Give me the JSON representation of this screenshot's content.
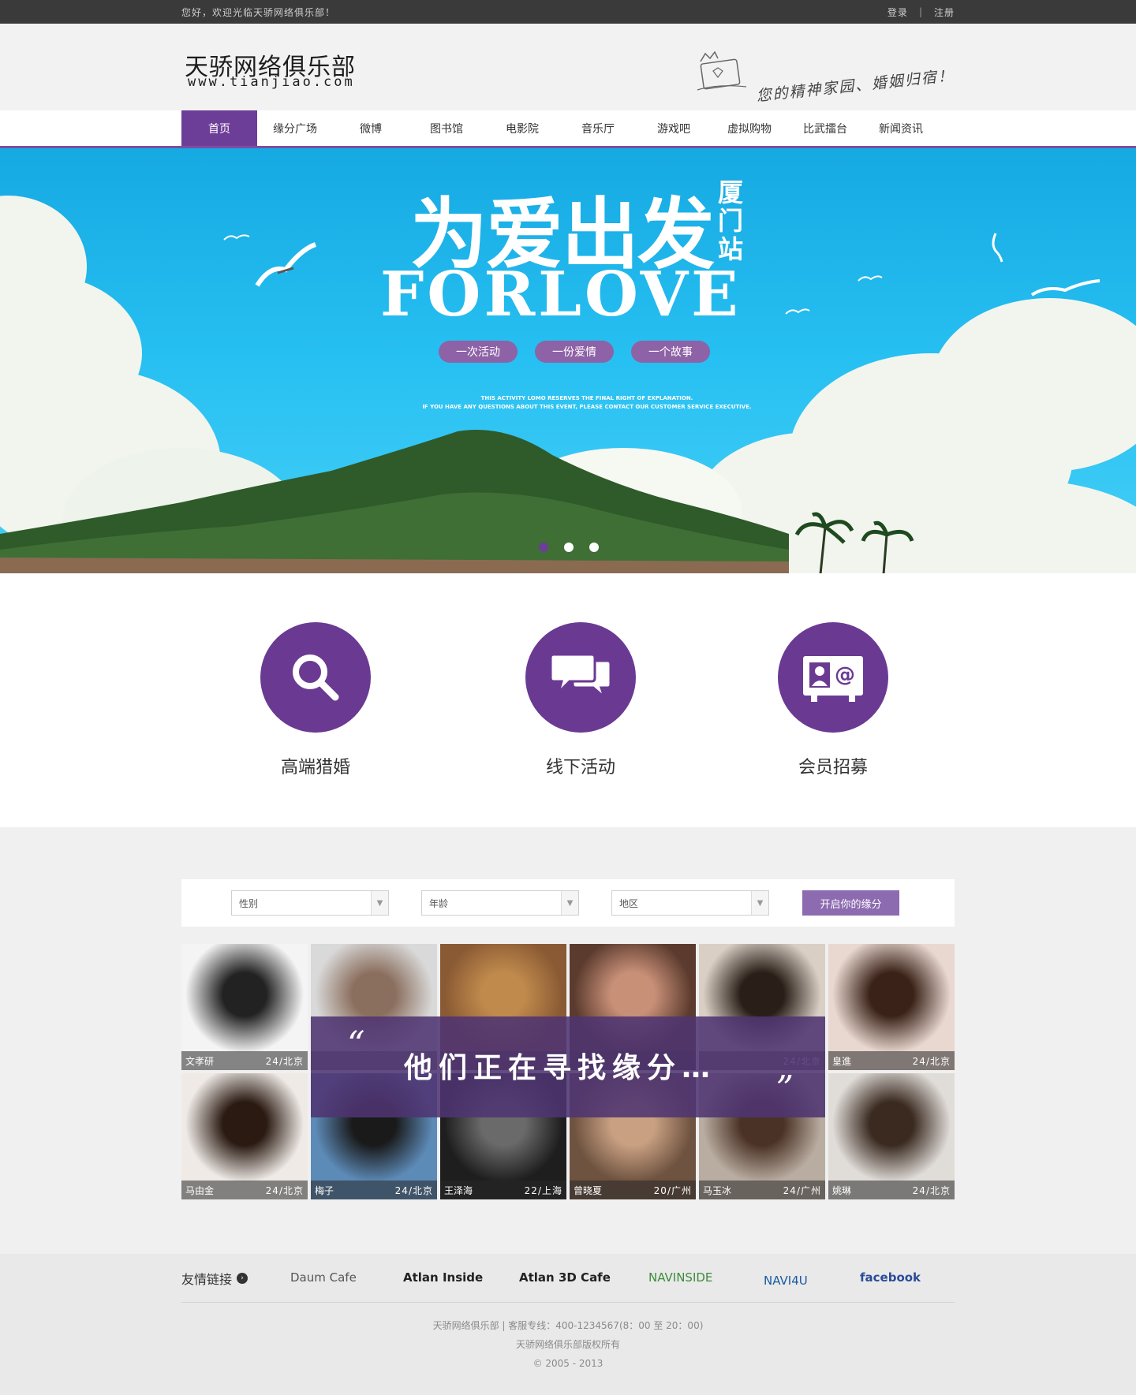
{
  "topbar": {
    "welcome": "您好，欢迎光临天骄网络俱乐部！",
    "login": "登录",
    "separator": "|",
    "register": "注册"
  },
  "header": {
    "logo_cn": "天骄网络俱乐部",
    "logo_en": "www.tianjiao.com",
    "slogan": "您的精神家园、婚姻归宿！"
  },
  "nav": {
    "items": [
      "首页",
      "缘分广场",
      "微博",
      "图书馆",
      "电影院",
      "音乐厅",
      "游戏吧",
      "虚拟购物",
      "比武擂台",
      "新闻资讯"
    ],
    "active_index": 0
  },
  "banner": {
    "headline": "为爱出发",
    "station": "厦门站",
    "english": "FORLOVE",
    "pills": [
      "一次活动",
      "一份爱情",
      "一个故事"
    ],
    "disclaimer_line1": "THIS ACTIVITY LOMO RESERVES THE FINAL RIGHT OF EXPLANATION.",
    "disclaimer_line2": "IF YOU HAVE ANY QUESTIONS ABOUT THIS EVENT, PLEASE CONTACT OUR CUSTOMER SERVICE EXECUTIVE.",
    "slide_count": 3,
    "active_slide": 0
  },
  "features": [
    {
      "label": "高端猎婚",
      "icon": "search-icon"
    },
    {
      "label": "线下活动",
      "icon": "chat-bubbles-icon"
    },
    {
      "label": "会员招募",
      "icon": "contact-card-icon"
    }
  ],
  "search": {
    "gender": "性别",
    "age": "年龄",
    "region": "地区",
    "button": "开启你的缘分"
  },
  "overlay": {
    "open_quote": "“",
    "message": "他们正在寻找缘分…",
    "close_quote": "”"
  },
  "members": [
    {
      "name": "文孝研",
      "meta": "24/北京"
    },
    {
      "name": "",
      "meta": ""
    },
    {
      "name": "",
      "meta": ""
    },
    {
      "name": "",
      "meta": ""
    },
    {
      "name": "",
      "meta": "24/北京"
    },
    {
      "name": "皇進",
      "meta": "24/北京"
    },
    {
      "name": "马由金",
      "meta": "24/北京"
    },
    {
      "name": "梅子",
      "meta": "24/北京"
    },
    {
      "name": "王泽海",
      "meta": "22/上海"
    },
    {
      "name": "曾晓夏",
      "meta": "20/广州"
    },
    {
      "name": "马玉冰",
      "meta": "24/广州"
    },
    {
      "name": "姚琳",
      "meta": "24/北京"
    }
  ],
  "footer": {
    "links_label": "友情链接",
    "partners": [
      "Daum Cafe",
      "Atlan Inside",
      "Atlan 3D Cafe",
      "NAVINSIDE",
      "NAVI4U",
      "facebook"
    ],
    "line1": "天骄网络俱乐部  |  客服专线：400-1234567(8：00 至 20：00)",
    "line2": "天骄网络俱乐部版权所有",
    "line3": "© 2005 - 2013"
  },
  "colors": {
    "accent": "#6d3e97",
    "button": "#8d6bb0",
    "sky": "#27c0f2"
  }
}
